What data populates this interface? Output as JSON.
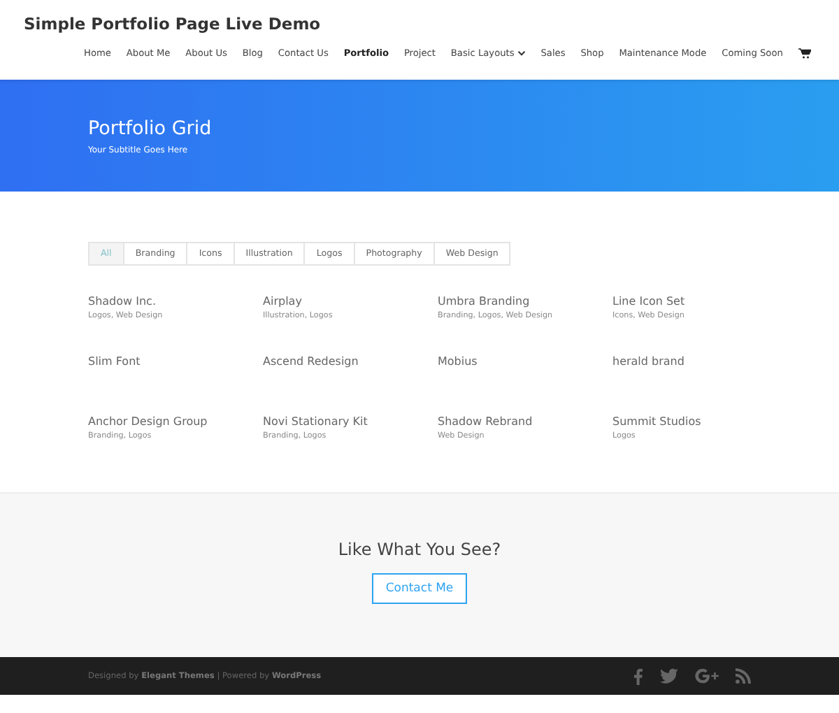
{
  "site_title": "Simple Portfolio Page Live Demo",
  "nav": [
    {
      "label": "Home",
      "selected": false
    },
    {
      "label": "About Me",
      "selected": false
    },
    {
      "label": "About Us",
      "selected": false
    },
    {
      "label": "Blog",
      "selected": false
    },
    {
      "label": "Contact Us",
      "selected": false
    },
    {
      "label": "Portfolio",
      "selected": true
    },
    {
      "label": "Project",
      "selected": false
    },
    {
      "label": "Basic Layouts",
      "selected": false,
      "dropdown": true
    },
    {
      "label": "Sales",
      "selected": false
    },
    {
      "label": "Shop",
      "selected": false
    },
    {
      "label": "Maintenance Mode",
      "selected": false
    },
    {
      "label": "Coming Soon",
      "selected": false
    }
  ],
  "hero": {
    "title": "Portfolio Grid",
    "subtitle": "Your Subtitle Goes Here"
  },
  "filters": [
    {
      "label": "All",
      "selected": true
    },
    {
      "label": "Branding",
      "selected": false
    },
    {
      "label": "Icons",
      "selected": false
    },
    {
      "label": "Illustration",
      "selected": false
    },
    {
      "label": "Logos",
      "selected": false
    },
    {
      "label": "Photography",
      "selected": false
    },
    {
      "label": "Web Design",
      "selected": false
    }
  ],
  "projects": [
    {
      "title": "Shadow Inc.",
      "tags": "Logos, Web Design"
    },
    {
      "title": "Airplay",
      "tags": "Illustration, Logos"
    },
    {
      "title": "Umbra Branding",
      "tags": "Branding, Logos, Web Design"
    },
    {
      "title": "Line Icon Set",
      "tags": "Icons, Web Design"
    },
    {
      "title": "Slim Font"
    },
    {
      "title": "Ascend Redesign"
    },
    {
      "title": "Mobius"
    },
    {
      "title": "herald brand"
    },
    {
      "title": "Anchor Design Group",
      "tags": "Branding, Logos"
    },
    {
      "title": "Novi Stationary Kit",
      "tags": "Branding, Logos"
    },
    {
      "title": "Shadow Rebrand",
      "tags": "Web Design"
    },
    {
      "title": "Summit Studios",
      "tags": "Logos"
    }
  ],
  "cta": {
    "heading": "Like What You See?",
    "button": "Contact Me"
  },
  "footer": {
    "credits": "Designed by **Elegant Themes** | Powered by **WordPress**",
    "social": [
      {
        "kind": "facebook"
      },
      {
        "kind": "twitter"
      },
      {
        "kind": "googleplus"
      },
      {
        "kind": "rss"
      }
    ]
  }
}
